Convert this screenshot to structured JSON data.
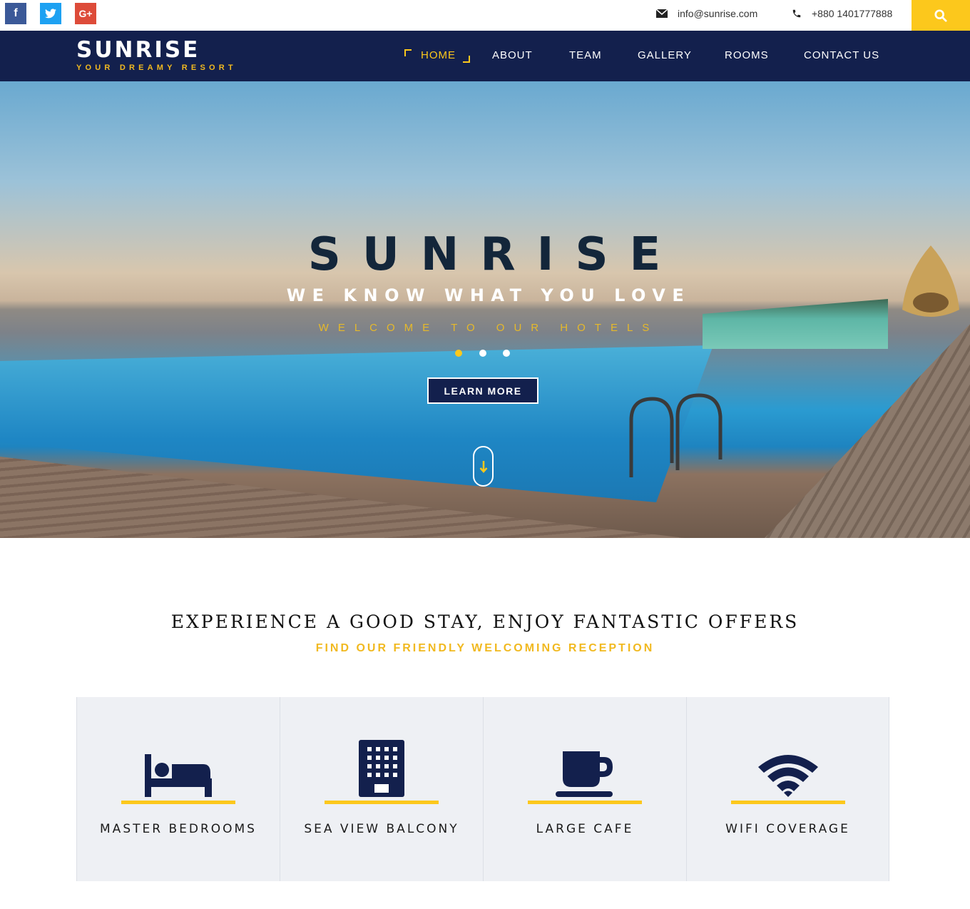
{
  "topbar": {
    "social": [
      {
        "name": "facebook",
        "glyph": "f"
      },
      {
        "name": "twitter",
        "glyph": "t"
      },
      {
        "name": "google-plus",
        "glyph": "G+"
      }
    ],
    "email": "info@sunrise.com",
    "phone": "+880 1401777888",
    "search_icon": "search-icon"
  },
  "brand": {
    "name": "SUNRISE",
    "tagline": "YOUR DREAMY RESORT"
  },
  "nav": {
    "items": [
      "HOME",
      "ABOUT",
      "TEAM",
      "GALLERY",
      "ROOMS",
      "CONTACT US"
    ],
    "active": "HOME"
  },
  "hero": {
    "title": "SUNRISE",
    "subtitle": "WE KNOW WHAT YOU LOVE",
    "welcome": "WELCOME TO OUR HOTELS",
    "slides": 3,
    "active_slide": 1,
    "cta": "LEARN MORE"
  },
  "offers": {
    "title": "EXPERIENCE A GOOD STAY, ENJOY FANTASTIC OFFERS",
    "subtitle": "FIND OUR FRIENDLY WELCOMING RECEPTION",
    "features": [
      {
        "label": "MASTER BEDROOMS",
        "icon": "bed-icon"
      },
      {
        "label": "SEA VIEW BALCONY",
        "icon": "building-icon"
      },
      {
        "label": "LARGE CAFE",
        "icon": "coffee-cup-icon"
      },
      {
        "label": "WIFI COVERAGE",
        "icon": "wifi-icon"
      }
    ]
  },
  "colors": {
    "navy": "#13204d",
    "accent": "#fcc81c",
    "panel": "#eef0f4"
  }
}
